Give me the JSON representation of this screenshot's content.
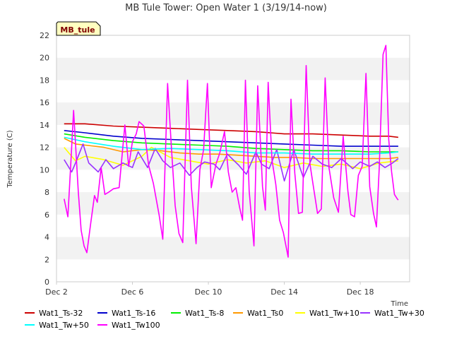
{
  "chart_data": {
    "type": "line",
    "title": "MB Tule Tower: Open Water 1 (3/19/14-now)",
    "xlabel": "Time",
    "ylabel": "Temperature (C)",
    "badge": "MB_tule",
    "ylim": [
      0,
      22
    ],
    "yticks": [
      0,
      2,
      4,
      6,
      8,
      10,
      12,
      14,
      16,
      18,
      20,
      22
    ],
    "xlim": [
      2.0,
      20.6
    ],
    "xticks": [
      {
        "value": 2,
        "label": "Dec 2"
      },
      {
        "value": 6,
        "label": "Dec 6"
      },
      {
        "value": 10,
        "label": "Dec 10"
      },
      {
        "value": 14,
        "label": "Dec 14"
      },
      {
        "value": 18,
        "label": "Dec 18"
      }
    ],
    "grid": "horizontal bands",
    "legend_position": "bottom",
    "colors": {
      "background_band": "#f2f2f2",
      "axis": "#cccccc",
      "badge_fill": "#ffffc0"
    },
    "series": [
      {
        "name": "Wat1_Ts-32",
        "color": "#cc0000",
        "x": [
          2.4,
          3.5,
          5,
          6.5,
          8,
          9.5,
          11,
          12.5,
          14,
          15.5,
          17,
          18.5,
          19.5,
          20.0
        ],
        "y": [
          14.1,
          14.1,
          13.9,
          13.8,
          13.7,
          13.6,
          13.5,
          13.4,
          13.2,
          13.2,
          13.1,
          13.0,
          13.0,
          12.9
        ]
      },
      {
        "name": "Wat1_Ts-16",
        "color": "#0000cc",
        "x": [
          2.4,
          3.5,
          5,
          6.5,
          8,
          9.5,
          11,
          12.5,
          14,
          15.5,
          17,
          18.5,
          19.5,
          20.0
        ],
        "y": [
          13.5,
          13.3,
          13.0,
          12.8,
          12.7,
          12.6,
          12.5,
          12.4,
          12.3,
          12.2,
          12.1,
          12.1,
          12.1,
          12.1
        ]
      },
      {
        "name": "Wat1_Ts-8",
        "color": "#00ee00",
        "x": [
          2.4,
          3.5,
          5,
          6.5,
          8,
          9.5,
          11,
          12.5,
          14,
          15.5,
          17,
          18.5,
          19.5,
          20.0
        ],
        "y": [
          13.2,
          12.9,
          12.6,
          12.4,
          12.3,
          12.2,
          12.1,
          11.9,
          11.8,
          11.7,
          11.7,
          11.6,
          11.6,
          11.6
        ]
      },
      {
        "name": "Wat1_Ts0",
        "color": "#ff9900",
        "x": [
          2.4,
          3.0,
          4.5,
          5.5,
          6.5,
          7.5,
          8.5,
          9.5,
          10.5,
          11.5,
          12.5,
          13.5,
          14.5,
          15.5,
          16.5,
          17.5,
          18.5,
          19.5,
          20.0
        ],
        "y": [
          12.8,
          12.3,
          12.0,
          11.6,
          11.8,
          11.7,
          11.5,
          11.4,
          11.4,
          11.3,
          11.2,
          11.1,
          11.1,
          11.0,
          11.0,
          11.0,
          11.0,
          11.0,
          11.1
        ]
      },
      {
        "name": "Wat1_Tw+10",
        "color": "#ffff00",
        "x": [
          2.4,
          3.0,
          3.5,
          4.5,
          5.5,
          6.5,
          7.0,
          8.0,
          9.0,
          10.0,
          11.0,
          12.0,
          13.0,
          14.0,
          15.0,
          16.0,
          17.0,
          18.0,
          19.0,
          20.0
        ],
        "y": [
          12.0,
          10.8,
          11.2,
          10.9,
          10.4,
          11.2,
          12.0,
          11.1,
          10.8,
          10.5,
          10.9,
          10.6,
          10.8,
          10.2,
          10.6,
          10.3,
          10.5,
          10.1,
          10.6,
          10.8
        ]
      },
      {
        "name": "Wat1_Tw+30",
        "color": "#9933ff",
        "x": [
          2.4,
          2.8,
          3.0,
          3.4,
          3.7,
          4.2,
          4.6,
          5.0,
          5.5,
          6.0,
          6.3,
          6.8,
          7.2,
          7.6,
          8.0,
          8.5,
          9.0,
          9.4,
          9.8,
          10.3,
          10.6,
          11.0,
          11.6,
          12.0,
          12.5,
          12.8,
          13.2,
          13.6,
          14.0,
          14.5,
          15.0,
          15.5,
          16.0,
          16.5,
          17.0,
          17.6,
          18.0,
          18.5,
          18.9,
          19.3,
          19.7,
          20.0
        ],
        "y": [
          10.9,
          9.8,
          10.6,
          12.3,
          10.6,
          9.8,
          10.9,
          10.1,
          10.6,
          10.2,
          11.6,
          10.2,
          11.9,
          10.8,
          10.2,
          10.6,
          9.5,
          10.2,
          10.7,
          10.5,
          10.0,
          11.4,
          10.4,
          9.6,
          11.6,
          10.5,
          10.1,
          11.8,
          9.0,
          11.8,
          9.3,
          11.2,
          10.5,
          10.2,
          11.0,
          10.1,
          10.7,
          10.3,
          10.7,
          10.2,
          10.6,
          11.0
        ]
      },
      {
        "name": "Wat1_Tw+50",
        "color": "#00ffff",
        "x": [
          2.4,
          3.5,
          5,
          6.5,
          8,
          9.5,
          11,
          12.5,
          14,
          15.5,
          17,
          18.5,
          19.5,
          20.0
        ],
        "y": [
          12.9,
          12.5,
          12.1,
          11.8,
          11.9,
          11.8,
          11.7,
          11.5,
          11.5,
          11.4,
          11.4,
          11.4,
          11.5,
          11.6
        ]
      },
      {
        "name": "Wat1_Tw100",
        "color": "#ff00ff",
        "x": [
          2.4,
          2.6,
          2.75,
          2.9,
          3.15,
          3.3,
          3.45,
          3.6,
          3.8,
          4.0,
          4.15,
          4.35,
          4.55,
          4.75,
          5.0,
          5.3,
          5.6,
          5.8,
          6.0,
          6.2,
          6.35,
          6.6,
          6.85,
          7.1,
          7.4,
          7.6,
          7.85,
          8.05,
          8.25,
          8.45,
          8.65,
          8.9,
          9.1,
          9.35,
          9.55,
          9.75,
          9.95,
          10.15,
          10.4,
          10.6,
          10.85,
          11.05,
          11.25,
          11.45,
          11.65,
          11.8,
          11.95,
          12.15,
          12.4,
          12.6,
          12.85,
          13.0,
          13.15,
          13.35,
          13.55,
          13.75,
          13.95,
          14.2,
          14.35,
          14.55,
          14.75,
          14.95,
          15.15,
          15.35,
          15.55,
          15.75,
          15.95,
          16.15,
          16.35,
          16.6,
          16.85,
          17.1,
          17.35,
          17.5,
          17.7,
          17.9,
          18.1,
          18.3,
          18.5,
          18.7,
          18.85,
          19.0,
          19.2,
          19.35,
          19.5,
          19.65,
          19.8,
          19.95,
          20.0
        ],
        "y": [
          7.4,
          5.8,
          10.5,
          15.3,
          8.0,
          4.6,
          3.2,
          2.6,
          5.2,
          7.7,
          7.1,
          10.2,
          7.8,
          8.0,
          8.3,
          8.4,
          14.0,
          10.3,
          12.5,
          13.2,
          14.3,
          13.9,
          10.4,
          8.8,
          6.0,
          3.8,
          17.7,
          12.1,
          6.8,
          4.3,
          3.5,
          18.0,
          8.5,
          3.4,
          10.0,
          11.8,
          17.7,
          8.4,
          10.5,
          11.5,
          13.4,
          9.8,
          8.0,
          8.4,
          6.6,
          5.5,
          18.0,
          8.1,
          3.2,
          17.5,
          8.5,
          6.4,
          17.8,
          10.9,
          8.7,
          5.5,
          4.4,
          2.2,
          16.3,
          9.7,
          6.1,
          6.2,
          19.3,
          10.5,
          8.3,
          6.1,
          6.5,
          18.2,
          10.2,
          7.5,
          6.2,
          13.0,
          8.1,
          6.0,
          5.8,
          9.5,
          10.3,
          18.6,
          8.5,
          6.1,
          4.9,
          10.2,
          20.3,
          21.1,
          12.7,
          9.8,
          7.8,
          7.4,
          7.3
        ]
      }
    ]
  }
}
